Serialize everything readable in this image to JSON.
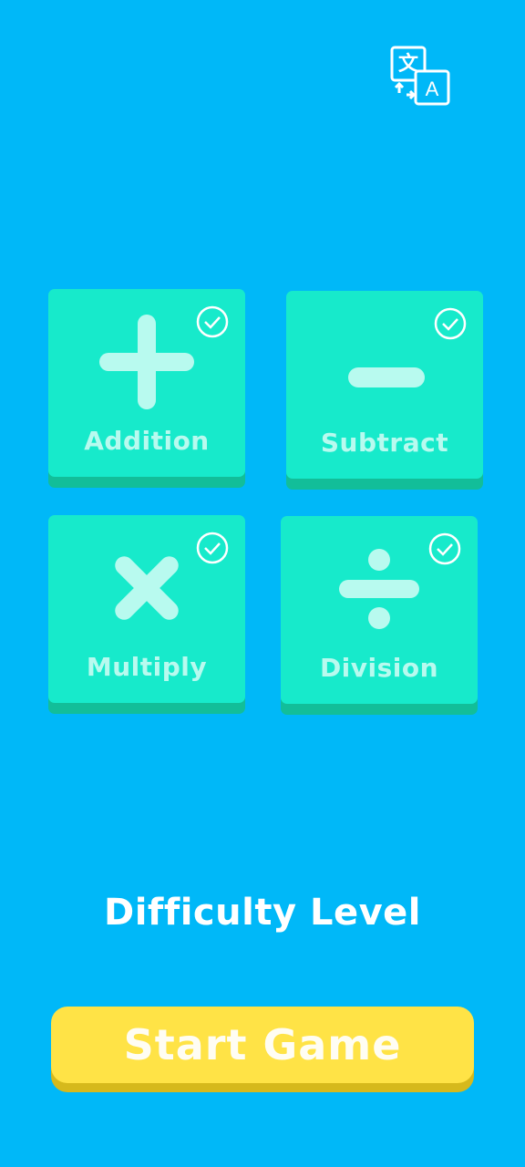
{
  "header": {
    "language_icon": "translate-icon"
  },
  "operations": [
    {
      "label": "Addition",
      "icon": "plus-icon",
      "selected": true
    },
    {
      "label": "Subtract",
      "icon": "minus-icon",
      "selected": true
    },
    {
      "label": "Multiply",
      "icon": "times-icon",
      "selected": true
    },
    {
      "label": "Division",
      "icon": "divide-icon",
      "selected": true
    }
  ],
  "difficulty": {
    "label": "Difficulty Level"
  },
  "actions": {
    "start_label": "Start Game"
  },
  "colors": {
    "background": "#00B8F8",
    "card": "#17EACB",
    "card_shadow": "#12BE99",
    "symbol": "#B8FAEF",
    "button": "#FFE346",
    "button_shadow": "#D6B91C"
  }
}
